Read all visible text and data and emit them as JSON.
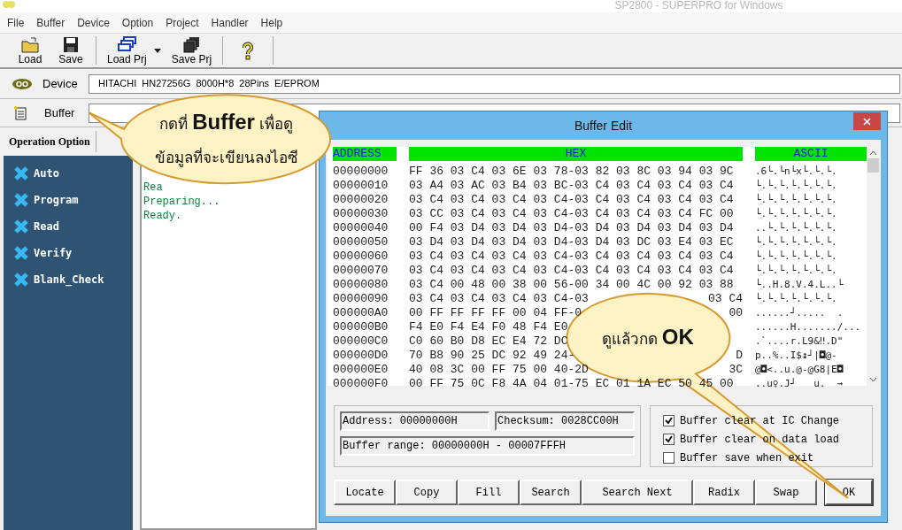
{
  "window": {
    "title": "SP2800 - SUPERPRO for Windows"
  },
  "menu": [
    "File",
    "Buffer",
    "Device",
    "Option",
    "Project",
    "Handler",
    "Help"
  ],
  "toolbar": [
    {
      "kind": "open",
      "label": "Load",
      "dropdown": false
    },
    {
      "kind": "save",
      "label": "Save",
      "dropdown": false
    },
    {
      "kind": "load_project",
      "label": "Load Prj",
      "dropdown": true
    },
    {
      "kind": "save_project",
      "label": "Save Prj",
      "dropdown": false
    },
    {
      "kind": "help",
      "dropdown": false
    }
  ],
  "device": {
    "label": "Device",
    "value": "HITACHI  HN27256G  8000H*8  28Pins  E/EPROM"
  },
  "buffer": {
    "label": "Buffer"
  },
  "operation_tab": {
    "label": "Operation Option"
  },
  "operations": [
    "Auto",
    "Program",
    "Read",
    "Verify",
    "Blank_Check"
  ],
  "log": [
    "Rea",
    "Preparing...",
    "Ready."
  ],
  "dialog": {
    "title": "Buffer Edit",
    "columns": [
      "ADDRESS",
      "HEX",
      "ASCII"
    ],
    "rows": [
      {
        "address": "00000000",
        "hex": "FF 36 03 C4 03 6E 03 78-03 82 03 8C 03 94 03 9C",
        "ascii": ".6└.└n└x└.└.└."
      },
      {
        "address": "00000010",
        "hex": "03 A4 03 AC 03 B4 03 BC-03 C4 03 C4 03 C4 03 C4",
        "ascii": "└.└.└.└.└.└.└."
      },
      {
        "address": "00000020",
        "hex": "03 C4 03 C4 03 C4 03 C4-03 C4 03 C4 03 C4 03 C4",
        "ascii": "└.└.└.└.└.└.└."
      },
      {
        "address": "00000030",
        "hex": "03 CC 03 C4 03 C4 03 C4-03 C4 03 C4 03 C4 FC 00",
        "ascii": "└.└.└.└.└.└.└."
      },
      {
        "address": "00000040",
        "hex": "00 F4 03 D4 03 D4 03 D4-03 D4 03 D4 03 D4 03 D4",
        "ascii": "..└.└.└.└.└.└."
      },
      {
        "address": "00000050",
        "hex": "03 D4 03 D4 03 D4 03 D4-03 D4 03 DC 03 E4 03 EC",
        "ascii": "└.└.└.└.└.└.└."
      },
      {
        "address": "00000060",
        "hex": "03 C4 03 C4 03 C4 03 C4-03 C4 03 C4 03 C4 03 C4",
        "ascii": "└.└.└.└.└.└.└."
      },
      {
        "address": "00000070",
        "hex": "03 C4 03 C4 03 C4 03 C4-03 C4 03 C4 03 C4 03 C4",
        "ascii": "└.└.└.└.└.└.└."
      },
      {
        "address": "00000080",
        "hex": "03 C4 00 48 00 38 00 56-00 34 00 4C 00 92 03 88",
        "ascii": "└..H.8.V.4.L..└"
      },
      {
        "address": "00000090",
        "hex": "03 C4 03 C4 03 C4 03 C4-03",
        "hex_end": "03 C4",
        "ascii": "└.└.└.└.└.└.└."
      },
      {
        "address": "000000A0",
        "hex": "00 FF FF FF FF 00 04 FF-0",
        "hex_end": "00",
        "ascii": "......┘.....  ."
      },
      {
        "address": "000000B0",
        "hex": "F4 E0 F4 E4 F0 48 F4 E0",
        "ascii": "......H......./..."
      },
      {
        "address": "000000C0",
        "hex": "C0 60 B0 D8 EC E4 72 DC",
        "ascii": ".`....r.L9&‼.D\""
      },
      {
        "address": "000000D0",
        "hex": "70 B8 90 25 DC 92 49 24-",
        "hex_end": "D",
        "ascii": "p..%..I$↨┘|◘@-"
      },
      {
        "address": "000000E0",
        "hex": "40 08 3C 00 FF 75 00 40-2D",
        "hex_end": "3C",
        "ascii": "@◘<..u.@-@G8|E◘"
      },
      {
        "address": "000000F0",
        "hex": "00 FF 75 0C F8 4A 04 01-75 EC 01 1A EC 50 45 00",
        "ascii": "..u♀.J┘   u.  →"
      }
    ],
    "address_field": "Address: 00000000H",
    "checksum_field": "Checksum: 0028CC00H",
    "range_field": "Buffer range: 00000000H - 00007FFFH",
    "options": [
      {
        "label": "Buffer clear at IC Change",
        "checked": true
      },
      {
        "label": "Buffer clear on data load",
        "checked": true
      },
      {
        "label": "Buffer save when exit",
        "checked": false
      }
    ],
    "buttons": [
      "Locate",
      "Copy",
      "Fill",
      "Search",
      "Search Next",
      "Radix",
      "Swap"
    ],
    "ok_button": "OK"
  },
  "callouts": [
    {
      "lines": [
        "กดที่ **Buffer** เพื่อดู",
        "ข้อมูลที่จะเขียนลงไอซี"
      ]
    },
    {
      "lines": [
        "ดูแล้วกด **OK**"
      ]
    }
  ]
}
